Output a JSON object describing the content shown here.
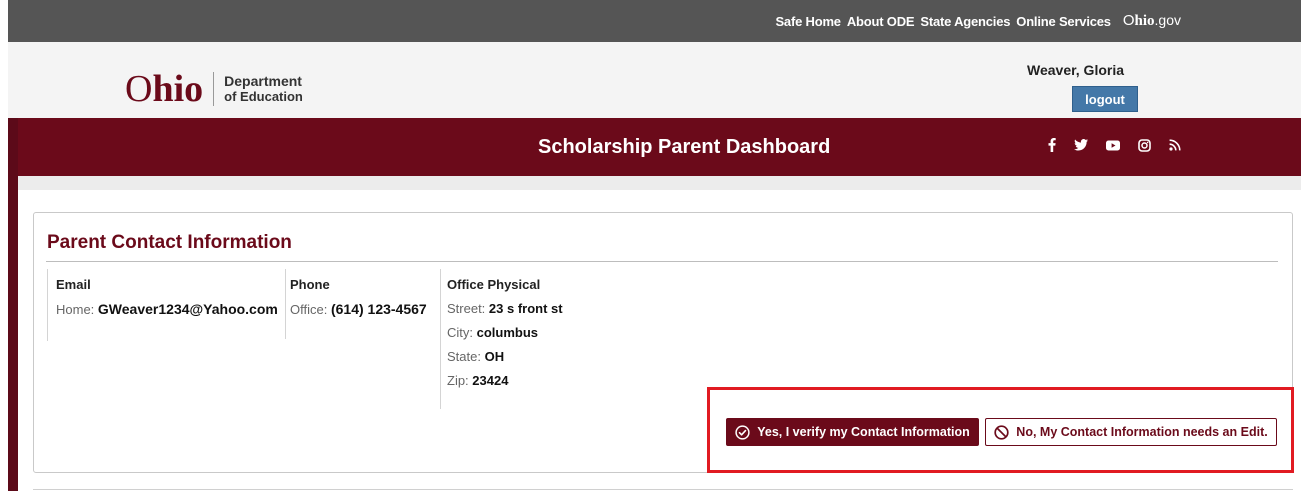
{
  "utility_bar": {
    "links": [
      "Safe Home",
      "About ODE",
      "State Agencies",
      "Online Services"
    ],
    "ohio_gov": {
      "o": "O",
      "hio": "hio",
      "gov": ".gov"
    }
  },
  "header": {
    "logo": {
      "o": "O",
      "hio": "hio",
      "dept_line1": "Department",
      "dept_line2": "of Education"
    },
    "user_name": "Weaver, Gloria",
    "logout_label": "logout"
  },
  "banner": {
    "title": "Scholarship Parent Dashboard",
    "social_icons": [
      "facebook-icon",
      "twitter-icon",
      "youtube-icon",
      "instagram-icon",
      "rss-icon"
    ]
  },
  "panel": {
    "title": "Parent Contact Information",
    "email": {
      "heading": "Email",
      "label": "Home:",
      "value": "GWeaver1234@Yahoo.com"
    },
    "phone": {
      "heading": "Phone",
      "label": "Office:",
      "value": "(614) 123-4567"
    },
    "office": {
      "heading": "Office Physical",
      "street_label": "Street:",
      "street": "23 s front st",
      "city_label": "City:",
      "city": "columbus",
      "state_label": "State:",
      "state": "OH",
      "zip_label": "Zip:",
      "zip": "23424"
    },
    "verify_button": "Yes, I verify my Contact Information",
    "edit_button": "No, My Contact Information needs an Edit."
  },
  "colors": {
    "brand_maroon": "#6b0a1a",
    "utility_gray": "#555555",
    "logout_blue": "#4478a8",
    "highlight_red": "#e11b22"
  }
}
